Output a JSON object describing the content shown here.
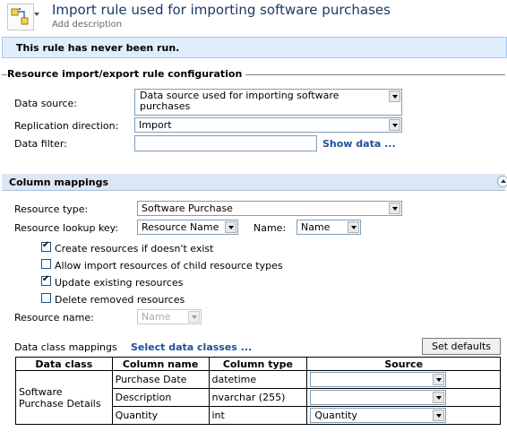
{
  "header": {
    "title": "Import rule used for importing software purchases",
    "add_description": "Add description"
  },
  "status_message": "This rule has never been run.",
  "config": {
    "section_title": "Resource import/export rule configuration",
    "data_source_label": "Data source:",
    "data_source_value": "Data source used for importing software purchases",
    "replication_label": "Replication direction:",
    "replication_value": "Import",
    "filter_label": "Data filter:",
    "filter_value": "",
    "show_data_link": "Show data ..."
  },
  "column_mappings": {
    "section_title": "Column mappings",
    "resource_type_label": "Resource type:",
    "resource_type_value": "Software Purchase",
    "lookup_key_label": "Resource lookup key:",
    "lookup_key_value": "Resource Name",
    "name_label": "Name:",
    "name_value": "Name",
    "checkboxes": [
      {
        "label": "Create resources if doesn't exist",
        "checked": true
      },
      {
        "label": "Allow import resources of child resource types",
        "checked": false
      },
      {
        "label": "Update existing resources",
        "checked": true
      },
      {
        "label": "Delete removed resources",
        "checked": false
      }
    ],
    "resource_name_label": "Resource name:",
    "resource_name_value": "Name",
    "data_class_mappings_label": "Data class mappings",
    "select_data_classes_link": "Select data classes ...",
    "set_defaults_button": "Set defaults",
    "table": {
      "headers": [
        "Data class",
        "Column name",
        "Column type",
        "Source"
      ],
      "data_class": "Software Purchase Details",
      "rows": [
        {
          "column_name": "Purchase Date",
          "column_type": "datetime",
          "source": ""
        },
        {
          "column_name": "Description",
          "column_type": "nvarchar (255)",
          "source": ""
        },
        {
          "column_name": "Quantity",
          "column_type": "int",
          "source": "Quantity"
        }
      ]
    }
  },
  "icons": {
    "rule_icon": "rule-flow-icon",
    "collapse_icon": "collapse-chevron-icon"
  },
  "colors": {
    "title": "#1a3a66",
    "status_bg": "#dfeefc",
    "link": "#1f4e9b",
    "section_header_bg": "#dce7f3"
  }
}
